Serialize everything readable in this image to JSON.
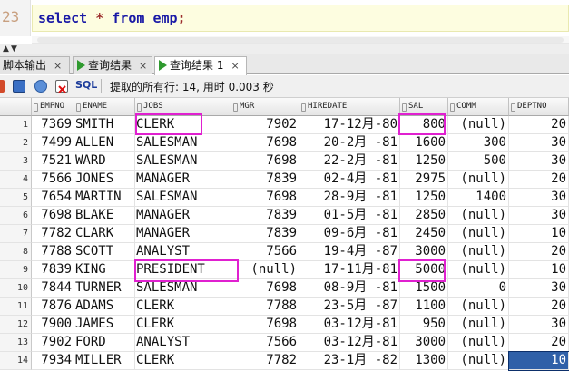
{
  "editor": {
    "line_number": "23",
    "code": {
      "keyword_select": "select",
      "star": "*",
      "keyword_from": "from",
      "table": "emp",
      "semicolon": ";"
    }
  },
  "tabs": [
    {
      "label": "脚本输出",
      "close": "×",
      "active": false
    },
    {
      "label": "查询结果",
      "close": "×",
      "active": false
    },
    {
      "label": "查询结果 1",
      "close": "×",
      "active": true
    }
  ],
  "toolbar": {
    "sql_label": "SQL",
    "status": "提取的所有行: 14, 用时 0.003 秒"
  },
  "grid": {
    "columns": [
      "EMPNO",
      "ENAME",
      "JOBS",
      "MGR",
      "HIREDATE",
      "SAL",
      "COMM",
      "DEPTNO"
    ],
    "rows": [
      [
        "1",
        "7369",
        "SMITH",
        "CLERK",
        "7902",
        "17-12月-80",
        "800",
        "(null)",
        "20"
      ],
      [
        "2",
        "7499",
        "ALLEN",
        "SALESMAN",
        "7698",
        "20-2月 -81",
        "1600",
        "300",
        "30"
      ],
      [
        "3",
        "7521",
        "WARD",
        "SALESMAN",
        "7698",
        "22-2月 -81",
        "1250",
        "500",
        "30"
      ],
      [
        "4",
        "7566",
        "JONES",
        "MANAGER",
        "7839",
        "02-4月 -81",
        "2975",
        "(null)",
        "20"
      ],
      [
        "5",
        "7654",
        "MARTIN",
        "SALESMAN",
        "7698",
        "28-9月 -81",
        "1250",
        "1400",
        "30"
      ],
      [
        "6",
        "7698",
        "BLAKE",
        "MANAGER",
        "7839",
        "01-5月 -81",
        "2850",
        "(null)",
        "30"
      ],
      [
        "7",
        "7782",
        "CLARK",
        "MANAGER",
        "7839",
        "09-6月 -81",
        "2450",
        "(null)",
        "10"
      ],
      [
        "8",
        "7788",
        "SCOTT",
        "ANALYST",
        "7566",
        "19-4月 -87",
        "3000",
        "(null)",
        "20"
      ],
      [
        "9",
        "7839",
        "KING",
        "PRESIDENT",
        "(null)",
        "17-11月-81",
        "5000",
        "(null)",
        "10"
      ],
      [
        "10",
        "7844",
        "TURNER",
        "SALESMAN",
        "7698",
        "08-9月 -81",
        "1500",
        "0",
        "30"
      ],
      [
        "11",
        "7876",
        "ADAMS",
        "CLERK",
        "7788",
        "23-5月 -87",
        "1100",
        "(null)",
        "20"
      ],
      [
        "12",
        "7900",
        "JAMES",
        "CLERK",
        "7698",
        "03-12月-81",
        "950",
        "(null)",
        "30"
      ],
      [
        "13",
        "7902",
        "FORD",
        "ANALYST",
        "7566",
        "03-12月-81",
        "3000",
        "(null)",
        "20"
      ],
      [
        "14",
        "7934",
        "MILLER",
        "CLERK",
        "7782",
        "23-1月 -82",
        "1300",
        "(null)",
        "10"
      ]
    ]
  },
  "colors": {
    "highlight_box": "#e020d0",
    "selected_cell": "#2f60a8"
  }
}
